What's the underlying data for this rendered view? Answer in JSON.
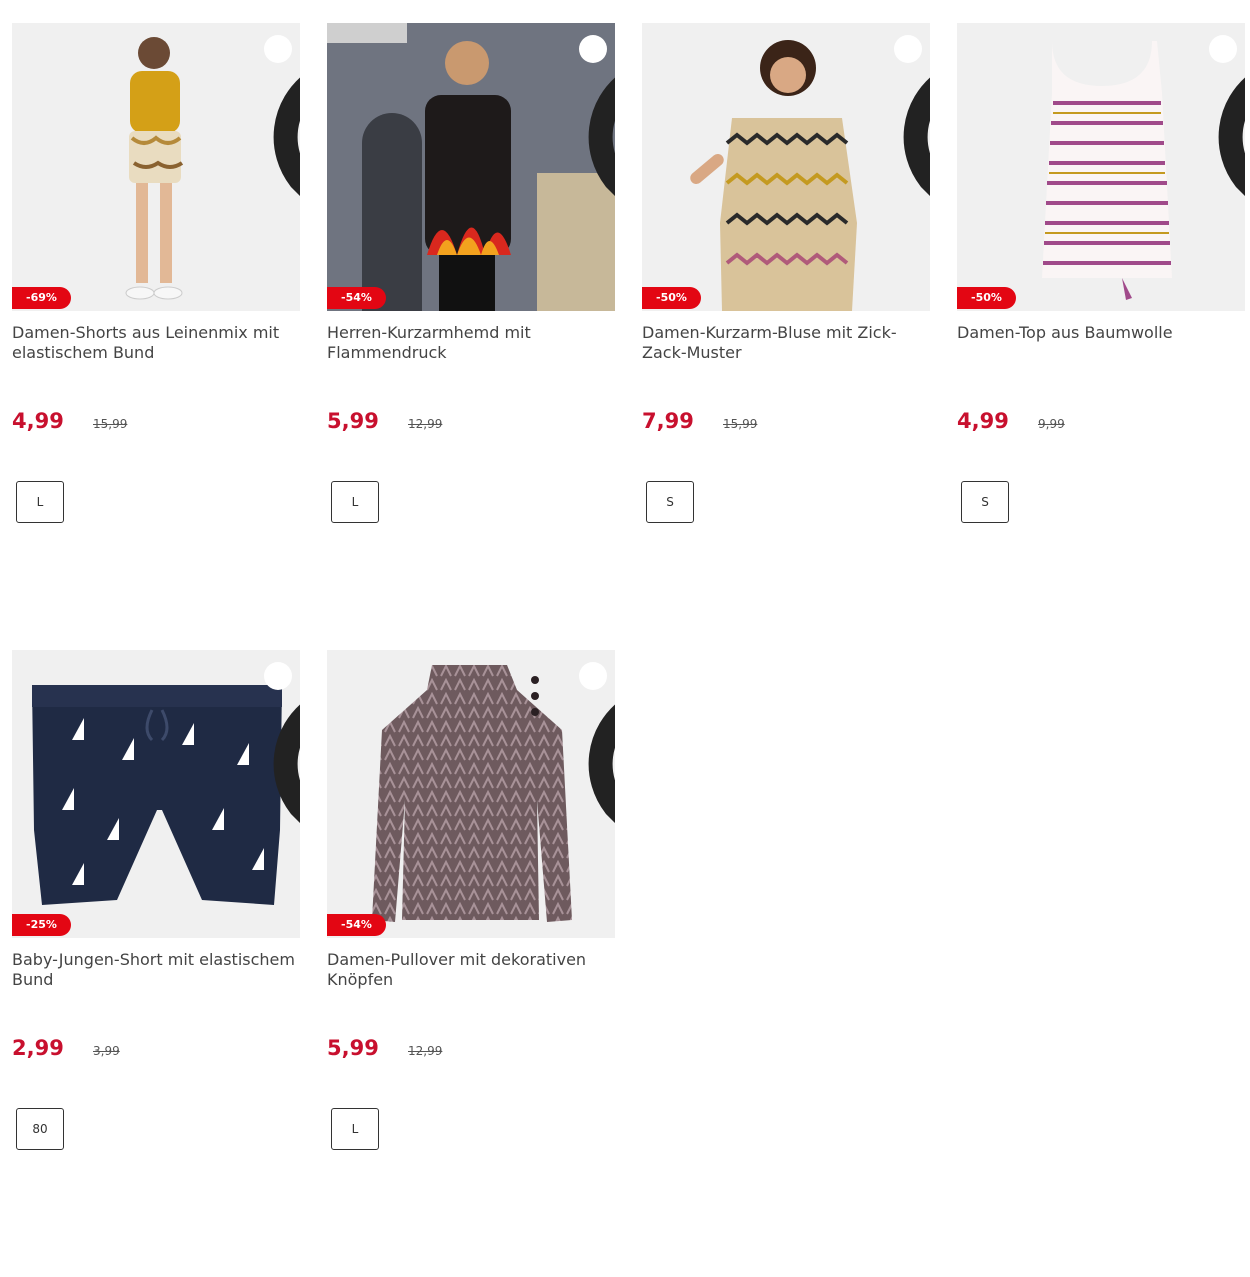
{
  "colors": {
    "accent": "#c8102e",
    "badge": "#e30613",
    "image_bg": "#eeeeee"
  },
  "products": [
    {
      "title": "Damen-Shorts aus Leinenmix mit elastischem Bund",
      "price": "4,99",
      "old_price": "15,99",
      "discount": "-69%",
      "size": "L",
      "image": "woman-mustard-top-shorts"
    },
    {
      "title": "Herren-Kurzarmhemd mit Flammendruck",
      "price": "5,99",
      "old_price": "12,99",
      "discount": "-54%",
      "size": "L",
      "image": "man-flame-shirt"
    },
    {
      "title": "Damen-Kurzarm-Bluse mit Zick-Zack-Muster",
      "price": "7,99",
      "old_price": "15,99",
      "discount": "-50%",
      "size": "S",
      "image": "woman-zigzag-blouse"
    },
    {
      "title": "Damen-Top aus Baumwolle",
      "price": "4,99",
      "old_price": "9,99",
      "discount": "-50%",
      "size": "S",
      "image": "striped-tank-top"
    },
    {
      "title": "Baby-Jungen-Short mit elastischem Bund",
      "price": "2,99",
      "old_price": "3,99",
      "discount": "-25%",
      "size": "80",
      "image": "navy-boat-shorts"
    },
    {
      "title": "Damen-Pullover mit dekorativen Knöpfen",
      "price": "5,99",
      "old_price": "12,99",
      "discount": "-54%",
      "size": "L",
      "image": "patterned-pullover"
    }
  ]
}
